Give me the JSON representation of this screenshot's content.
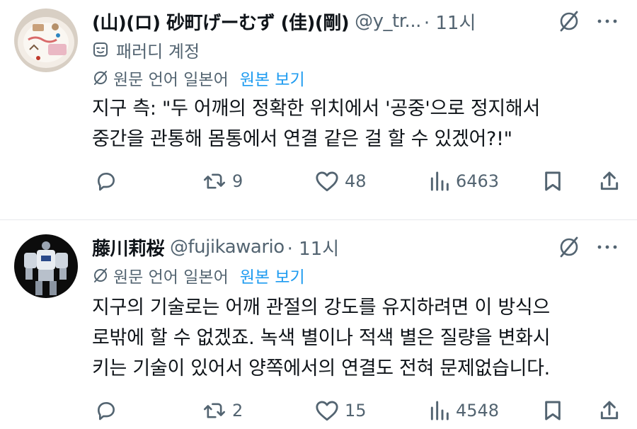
{
  "colors": {
    "text": "#0f1419",
    "secondary": "#536471",
    "link": "#1d9bf0",
    "divider": "#e6e9ec"
  },
  "tweets": [
    {
      "author": "(山)(ロ) 砂町げーむず (佳)(剛)",
      "handle": "@y_tr...",
      "time": "· 11시",
      "parody_label": "패러디 계정",
      "translation": {
        "label": "원문 언어 일본어",
        "link": "원본 보기"
      },
      "lines": [
        "지구 측: \"두 어깨의 정확한 위치에서 '공중'으로 정지해서",
        "중간을 관통해 몸통에서 연결 같은 걸 할 수 있겠어?!\""
      ],
      "stats": {
        "replies": "",
        "reposts": "9",
        "likes": "48",
        "views": "6463"
      }
    },
    {
      "author": "藤川莉桜",
      "handle": "@fujikawario",
      "time": "· 11시",
      "translation": {
        "label": "원문 언어 일본어",
        "link": "원본 보기"
      },
      "lines": [
        "지구의 기술로는 어깨 관절의 강도를 유지하려면 이 방식으",
        "로밖에 할 수 없겠죠. 녹색 별이나 적색 별은 질량을 변화시",
        "키는 기술이 있어서 양쪽에서의 연결도 전혀 문제없습니다."
      ],
      "stats": {
        "replies": "",
        "reposts": "2",
        "likes": "15",
        "views": "4548"
      }
    }
  ],
  "icons": {
    "reply": "reply-icon",
    "repost": "repost-icon",
    "like": "like-icon",
    "views": "views-icon",
    "bookmark": "bookmark-icon",
    "share": "share-icon",
    "grok": "grok-icon",
    "more": "more-icon",
    "translate": "translate-icon",
    "mask": "parody-mask-icon"
  }
}
